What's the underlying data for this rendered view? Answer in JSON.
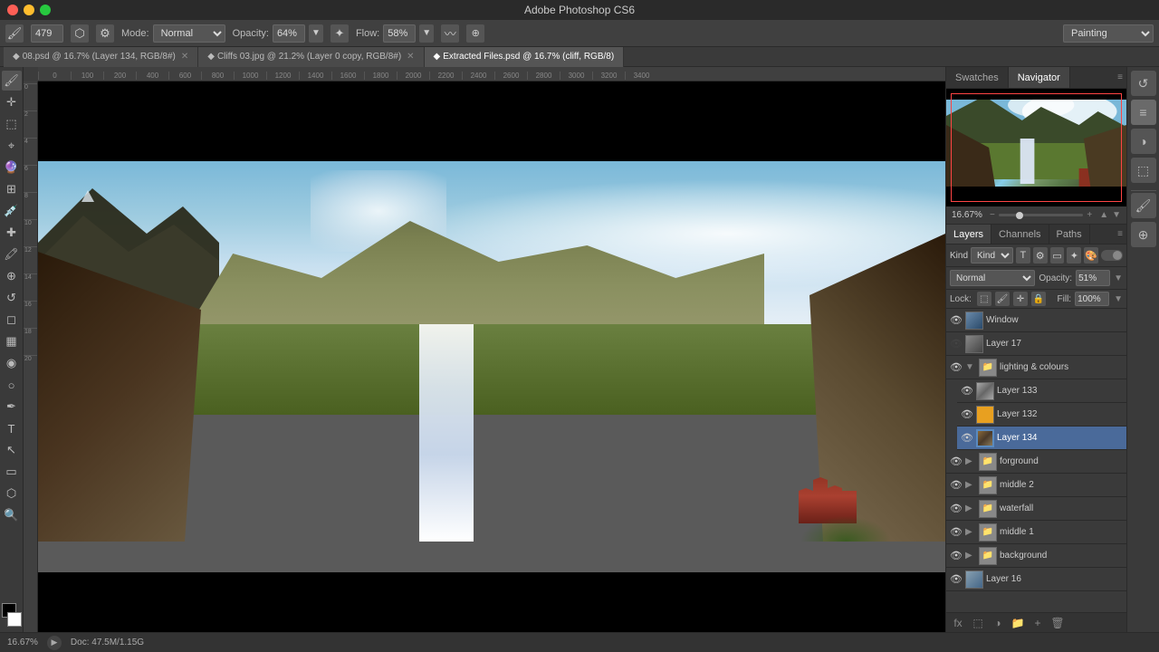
{
  "titleBar": {
    "title": "Adobe Photoshop CS6"
  },
  "toolbar": {
    "brushSize": "479",
    "modeLabel": "Mode:",
    "modeValue": "Normal",
    "opacityLabel": "Opacity:",
    "opacityValue": "64%",
    "flowLabel": "Flow:",
    "flowValue": "58%",
    "workspace": "Painting"
  },
  "tabs": [
    {
      "label": "08.psd @ 16.7% (Layer 134, RGB/8#)",
      "active": false,
      "closeable": true
    },
    {
      "label": "Cliffs 03.jpg @ 21.2% (Layer 0 copy, RGB/8#)",
      "active": false,
      "closeable": true
    },
    {
      "label": "Extracted Files.psd @ 16.7% (cliff, RGB/8)",
      "active": true,
      "closeable": false
    }
  ],
  "panelTabs": [
    {
      "label": "Swatches",
      "active": false
    },
    {
      "label": "Navigator",
      "active": true
    }
  ],
  "navigator": {
    "zoom": "16.67%"
  },
  "layersTabs": [
    {
      "label": "Layers",
      "active": true
    },
    {
      "label": "Channels",
      "active": false
    },
    {
      "label": "Paths",
      "active": false
    }
  ],
  "layersToolbar": {
    "kindLabel": "Kind",
    "filterIcons": [
      "🔤",
      "🖌",
      "⚙",
      "✦",
      "🎨"
    ]
  },
  "blending": {
    "mode": "Normal",
    "opacityLabel": "Opacity:",
    "opacityValue": "51%"
  },
  "lock": {
    "label": "Lock:",
    "fillLabel": "Fill:",
    "fillValue": "100%"
  },
  "layers": [
    {
      "name": "Window",
      "visible": true,
      "type": "layer",
      "thumbClass": "thumb-window",
      "indent": 0,
      "selected": false,
      "hasEye": true
    },
    {
      "name": "Layer 17",
      "visible": false,
      "type": "layer",
      "thumbClass": "thumb-layer17",
      "indent": 0,
      "selected": false,
      "hasEye": true
    },
    {
      "name": "lighting & colours",
      "visible": true,
      "type": "folder",
      "thumbClass": "thumb-group",
      "indent": 0,
      "selected": false,
      "hasEye": true,
      "expanded": true
    },
    {
      "name": "Layer 133",
      "visible": true,
      "type": "layer",
      "thumbClass": "thumb-l133",
      "indent": 1,
      "selected": false,
      "hasEye": true
    },
    {
      "name": "Layer 132",
      "visible": true,
      "type": "layer",
      "thumbClass": "thumb-l132",
      "indent": 1,
      "selected": false,
      "hasEye": true
    },
    {
      "name": "Layer 134",
      "visible": true,
      "type": "layer",
      "thumbClass": "thumb-l134",
      "indent": 1,
      "selected": true,
      "hasEye": true
    },
    {
      "name": "forground",
      "visible": true,
      "type": "folder",
      "thumbClass": "thumb-forground",
      "indent": 0,
      "selected": false,
      "hasEye": true,
      "expanded": false
    },
    {
      "name": "middle 2",
      "visible": true,
      "type": "folder",
      "thumbClass": "thumb-middle2",
      "indent": 0,
      "selected": false,
      "hasEye": true,
      "expanded": false
    },
    {
      "name": "waterfall",
      "visible": true,
      "type": "folder",
      "thumbClass": "thumb-waterfall",
      "indent": 0,
      "selected": false,
      "hasEye": true,
      "expanded": false
    },
    {
      "name": "middle 1",
      "visible": true,
      "type": "folder",
      "thumbClass": "thumb-middle1",
      "indent": 0,
      "selected": false,
      "hasEye": true,
      "expanded": false
    },
    {
      "name": "background",
      "visible": true,
      "type": "folder",
      "thumbClass": "thumb-background",
      "indent": 0,
      "selected": false,
      "hasEye": true,
      "expanded": false
    },
    {
      "name": "Layer 16",
      "visible": true,
      "type": "layer",
      "thumbClass": "thumb-l16",
      "indent": 0,
      "selected": false,
      "hasEye": true
    }
  ],
  "statusBar": {
    "zoom": "16.67%",
    "docInfo": "Doc: 47.5M/1.15G"
  },
  "icons": {
    "eye": "👁",
    "folder": "📁",
    "expand": "▶",
    "collapse": "▼",
    "chain": "🔗",
    "lock": "🔒",
    "brush": "🖌",
    "eraser": "◻",
    "move": "✛",
    "lasso": "⌖",
    "clone": "⊕",
    "zoom": "🔍"
  }
}
